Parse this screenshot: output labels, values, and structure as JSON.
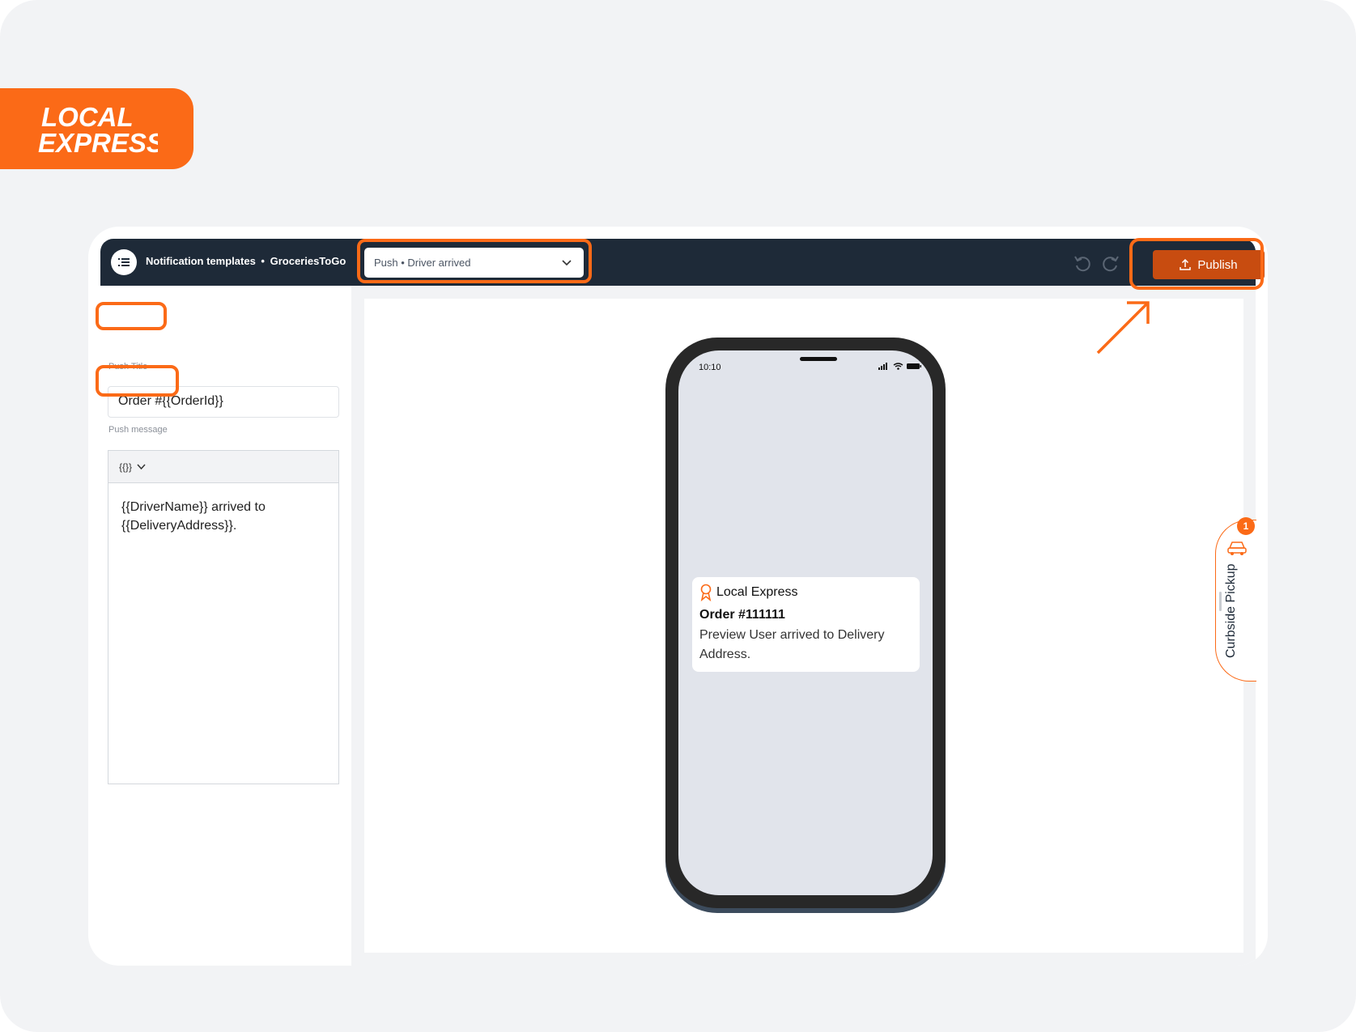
{
  "brand": {
    "logo_text_line1": "LOCAL",
    "logo_text_line2": "EXPRESS",
    "accent_color": "#fb6a17"
  },
  "app_bar": {
    "menu_icon": "menu-list-icon",
    "title": "Notification templates",
    "separator": "•",
    "store": "GroceriesToGo",
    "template_select": {
      "value": "Push • Driver arrived",
      "icon": "chevron-down-icon"
    },
    "undo_icon": "undo-icon",
    "redo_icon": "redo-icon",
    "publish_label": "Publish",
    "publish_icon": "upload-icon",
    "bar_color": "#1e2a38",
    "publish_color": "#c84c10"
  },
  "form": {
    "push_title_label": "Push Title",
    "push_title_value": "Order #{{OrderId}}",
    "push_message_label": "Push message",
    "variables_button": "{{}}",
    "push_message_value": "{{DriverName}} arrived to {{DeliveryAddress}}."
  },
  "preview": {
    "status_time": "10:10",
    "notification": {
      "app_name": "Local Express",
      "title": "Order #111111",
      "body": "Preview User arrived to Delivery Address."
    }
  },
  "curbside": {
    "label": "Curbside Pickup",
    "badge": "1",
    "icon": "car-icon"
  }
}
